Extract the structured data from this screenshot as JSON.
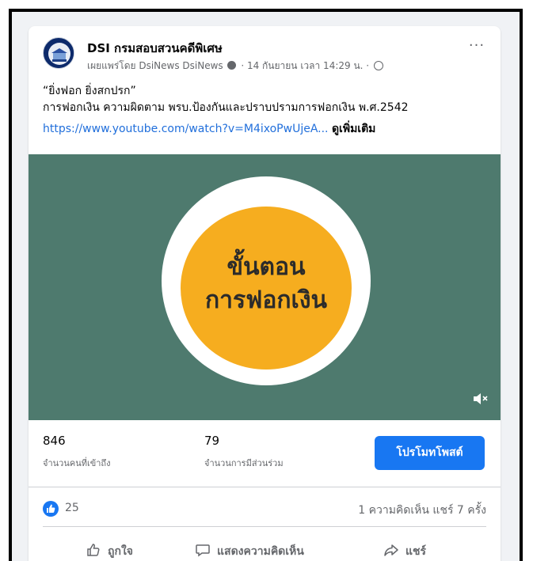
{
  "post": {
    "page_name": "DSI กรมสอบสวนคดีพิเศษ",
    "meta_publisher": "เผยแพร่โดย DsiNews DsiNews",
    "meta_datetime": "· 14 กันยายน เวลา 14:29 น. ·",
    "more": "···",
    "text_line1": "“ยิ่งฟอก ยิ่งสกปรก”",
    "text_line2": "การฟอกเงิน ความผิดตาม พรบ.ป้องกันและปราบปรามการฟอกเงิน พ.ศ.2542",
    "link": "https://www.youtube.com/watch?v=M4ixoPwUjeA...",
    "see_more": "ดูเพิ่มเติม"
  },
  "video": {
    "title_line1": "ขั้นตอน",
    "title_line2": "การฟอกเงิน",
    "colors": {
      "background": "#4e7a6e",
      "circle": "#f6ad1f",
      "ring": "#ffffff"
    }
  },
  "stats": {
    "reach_value": "846",
    "reach_label": "จำนวนคนที่เข้าถึง",
    "engagement_value": "79",
    "engagement_label": "จำนวนการมีส่วนร่วม",
    "promote_label": "โปรโมทโพสต์"
  },
  "reactions": {
    "like_count": "25",
    "comments_shares": "1 ความคิดเห็น  แชร์ 7 ครั้ง"
  },
  "actions": {
    "like_label": "ถูกใจ",
    "comment_label": "แสดงความคิดเห็น",
    "share_label": "แชร์"
  },
  "icons": [
    "page-avatar",
    "info-icon",
    "globe-icon",
    "more-icon",
    "mute-icon",
    "like-reaction-icon",
    "thumbs-up-icon",
    "comment-icon",
    "share-icon"
  ],
  "colors": {
    "accent": "#1877f2",
    "link": "#216fdb",
    "muted_text": "#65676b"
  }
}
